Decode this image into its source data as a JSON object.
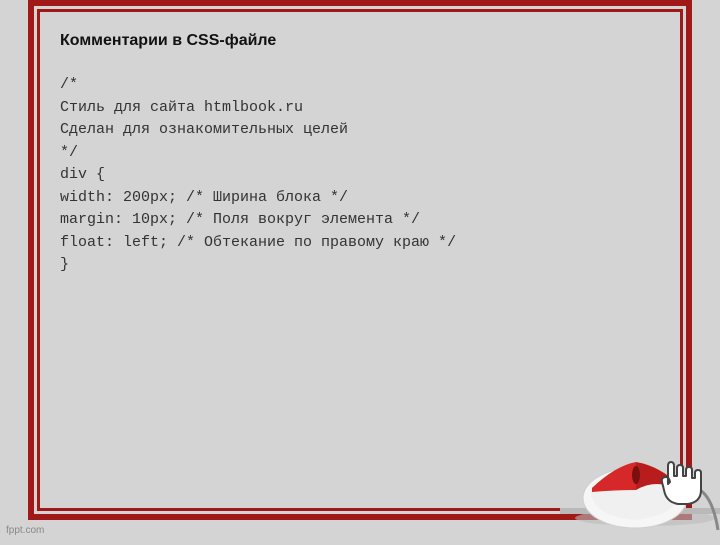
{
  "heading": "Комментарии в CSS-файле",
  "code": {
    "l1": "/*",
    "l2": "  Стиль для сайта htmlbook.ru",
    "l3": "  Сделан для ознакомительных целей",
    "l4": "*/",
    "l5": "",
    "l6": "div {",
    "l7": "   width: 200px; /* Ширина блока */",
    "l8": "   margin: 10px; /* Поля  вокруг элемента */",
    "l9": "   float: left; /* Обтекание по правому краю */",
    "l10": "}"
  },
  "watermark": "fppt.com"
}
